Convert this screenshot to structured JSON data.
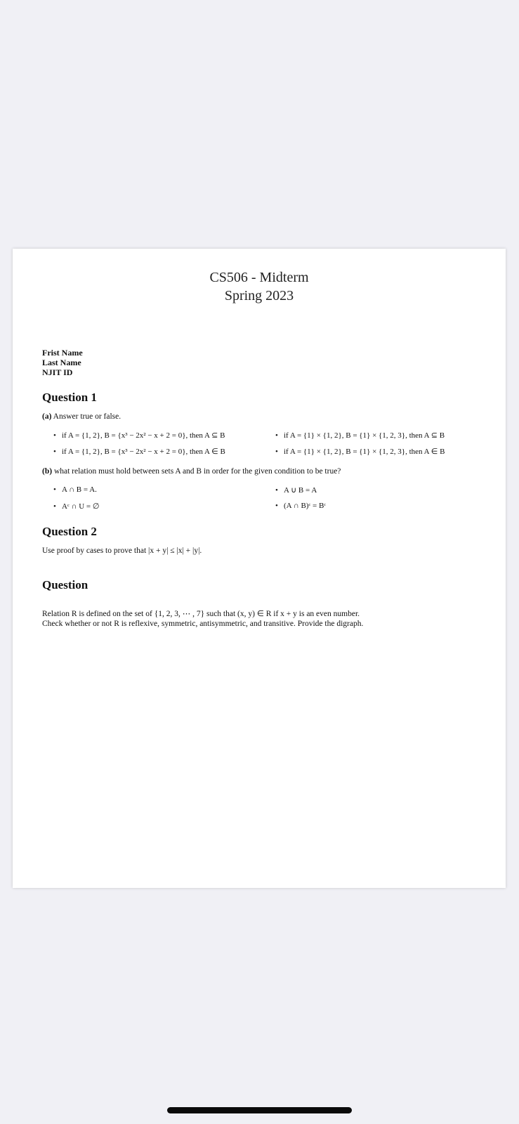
{
  "document": {
    "title_line1": "CS506 - Midterm",
    "title_line2": "Spring 2023",
    "fields": {
      "first_name": "Frist Name",
      "last_name": "Last Name",
      "id": "NJIT ID"
    },
    "question1": {
      "heading": "Question 1",
      "part_a_label": "(a)",
      "part_a_text": "Answer true or false.",
      "part_a_items": [
        "if A = {1, 2}, B = {x³ − 2x² − x + 2 = 0}, then A ⊆ B",
        "if A = {1} × {1, 2}, B = {1} × {1, 2, 3}, then A ⊆ B",
        "if A = {1, 2}, B = {x³ − 2x² − x + 2 = 0}, then A ∈ B",
        "if A = {1} × {1, 2}, B = {1} × {1, 2, 3}, then A ∈ B"
      ],
      "part_b_label": "(b)",
      "part_b_text": "what relation must hold between sets A and B in order for the given condition to be true?",
      "part_b_items": [
        "A ∩ B = A.",
        "A ∪ B = A",
        "Aᶜ ∩ U = ∅",
        "(A ∩ B)ᶜ = Bᶜ"
      ]
    },
    "question2": {
      "heading": "Question 2",
      "text": "Use proof by cases to prove that |x + y| ≤ |x| + |y|."
    },
    "question3": {
      "heading": "Question",
      "line1": "Relation R is defined on the set of {1, 2, 3, ⋯ , 7} such that (x, y) ∈ R    if    x + y    is an even number.",
      "line2": "Check whether or not R is reflexive, symmetric, antisymmetric, and transitive. Provide the digraph."
    }
  }
}
